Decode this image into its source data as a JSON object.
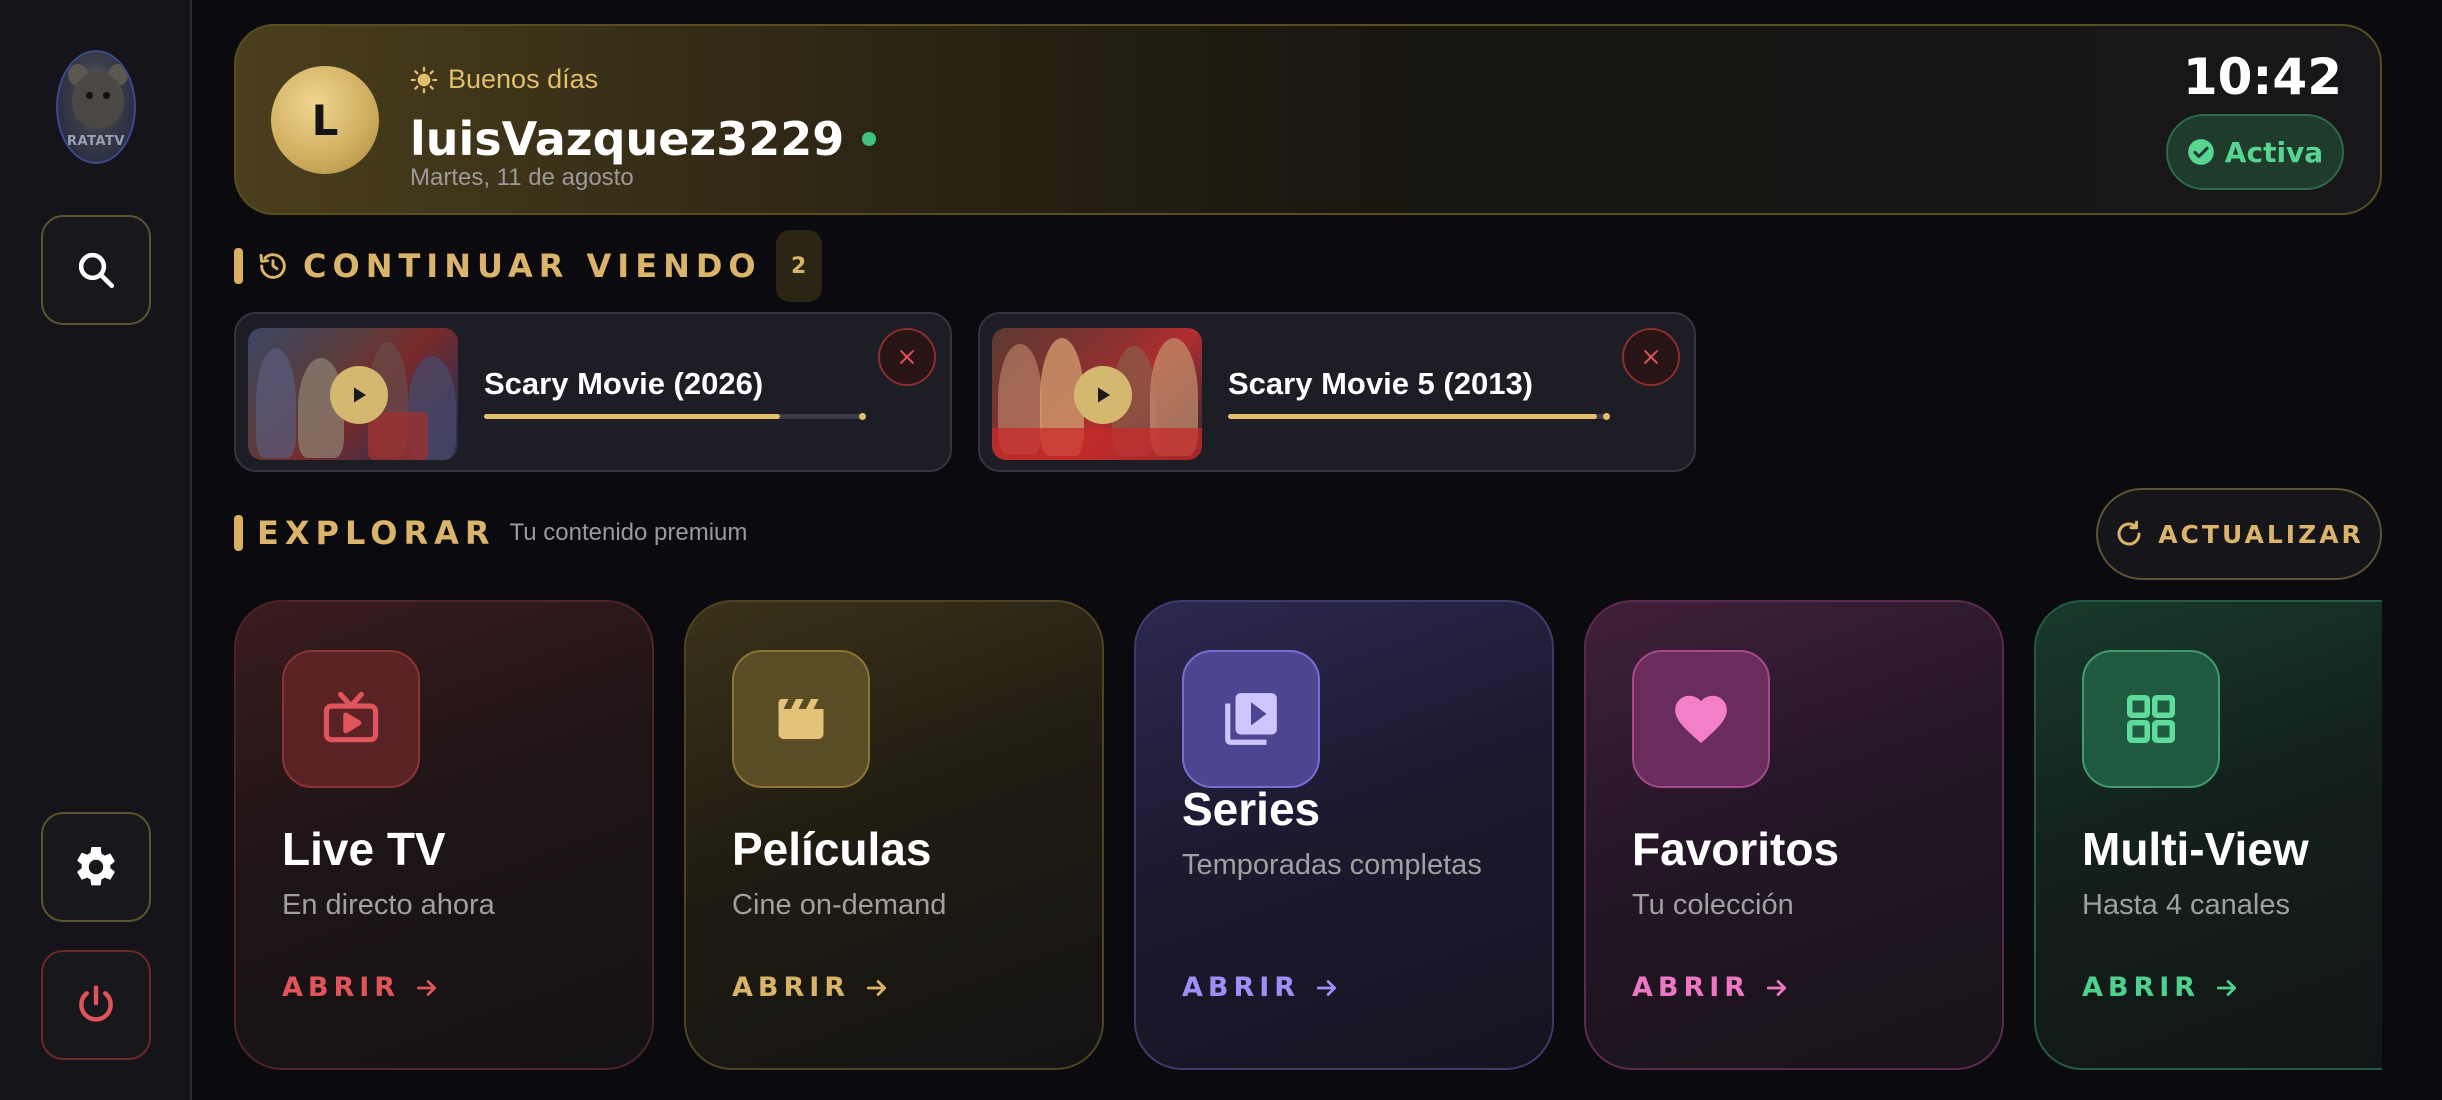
{
  "sidebar": {
    "logo_text": "RATATV",
    "search_icon": "search-icon",
    "settings_icon": "gear-icon",
    "power_icon": "power-icon"
  },
  "header": {
    "avatar_initial": "L",
    "greeting": "Buenos días",
    "username": "luisVazquez3229",
    "date": "Martes, 11 de agosto",
    "time": "10:42",
    "status": "Activa"
  },
  "continue_watching": {
    "title": "CONTINUAR VIENDO",
    "count": "2",
    "items": [
      {
        "title": "Scary Movie (2026)",
        "progress": 0.78
      },
      {
        "title": "Scary Movie 5 (2013)",
        "progress": 0.97
      }
    ]
  },
  "explore": {
    "title": "EXPLORAR",
    "subtitle": "Tu contenido premium",
    "refresh_label": "ACTUALIZAR",
    "categories": [
      {
        "title": "Live TV",
        "subtitle": "En directo ahora",
        "action": "ABRIR",
        "icon": "tv-icon",
        "color": "#e0555a"
      },
      {
        "title": "Películas",
        "subtitle": "Cine on-demand",
        "action": "ABRIR",
        "icon": "clapperboard-icon",
        "color": "#d8b468"
      },
      {
        "title": "Series",
        "subtitle": "Temporadas completas",
        "action": "ABRIR",
        "icon": "video-library-icon",
        "color": "#a08ef6"
      },
      {
        "title": "Favoritos",
        "subtitle": "Tu colección",
        "action": "ABRIR",
        "icon": "heart-icon",
        "color": "#ee77c2"
      },
      {
        "title": "Multi-View",
        "subtitle": "Hasta 4 canales",
        "action": "ABRIR",
        "icon": "grid-icon",
        "color": "#4fd08c"
      }
    ]
  },
  "colors": {
    "accent_gold": "#d9b46a",
    "active_green": "#58d493",
    "danger_red": "#e0555a"
  }
}
